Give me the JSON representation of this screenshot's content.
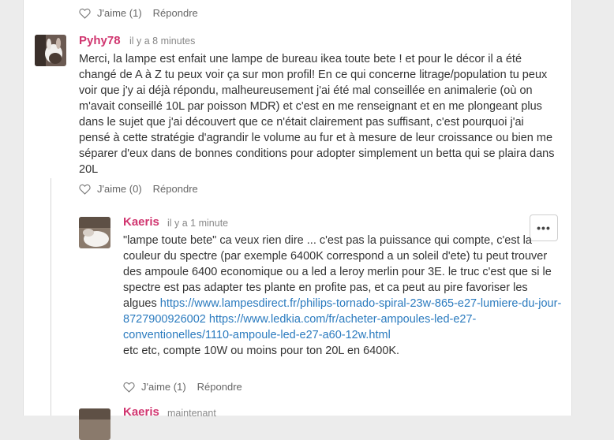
{
  "top_actions": {
    "like_label": "J'aime (1)",
    "reply_label": "Répondre"
  },
  "comment1": {
    "author": "Pyhy78",
    "time": "il y a 8 minutes",
    "text": "Merci, la lampe est enfait une lampe de bureau ikea toute bete ! et pour le décor il a été changé de A à Z tu peux voir ça sur mon profil! En ce qui concerne litrage/population tu peux voir que j'y ai déjà répondu, malheureusement j'ai été mal conseillée en animalerie (où on m'avait conseillé 10L par poisson MDR) et c'est en me renseignant et en me plongeant plus dans le sujet que j'ai découvert que ce n'était clairement pas suffisant, c'est pourquoi j'ai pensé à cette stratégie d'agrandir le volume au fur et à mesure de leur croissance ou bien me séparer d'eux dans de bonnes conditions pour adopter simplement un betta qui se plaira dans 20L",
    "like_label": "J'aime (0)",
    "reply_label": "Répondre"
  },
  "reply1": {
    "author": "Kaeris",
    "time": "il y a 1 minute",
    "text": "\"lampe toute bete\" ca veux rien dire ... c'est pas la puissance qui compte, c'est la couleur du spectre (par exemple 6400K correspond a un soleil d'ete) tu peut trouver des ampoule 6400 economique ou a led a leroy merlin pour 3E. le truc c'est que si le spectre est pas adapter tes plante en profite pas, et ca peut au pire favoriser les algues",
    "link1": "https://www.lampesdirect.fr/philips-tornado-spiral-23w-865-e27-lumiere-du-jour-8727900926002",
    "link2": "https://www.ledkia.com/fr/acheter-ampoules-led-e27-conventionelles/1110-ampoule-led-e27-a60-12w.html",
    "tail": "etc etc, compte 10W ou moins pour ton 20L en 6400K.",
    "like_label": "J'aime (1)",
    "reply_label": "Répondre",
    "menu_label": "•••"
  },
  "reply2": {
    "author": "Kaeris",
    "time": "maintenant"
  },
  "colors": {
    "author": "#d0356f",
    "link": "#2b7bbf",
    "background": "#ececec"
  },
  "icons": {
    "like": "heart-icon",
    "menu": "more-horizontal-icon"
  }
}
